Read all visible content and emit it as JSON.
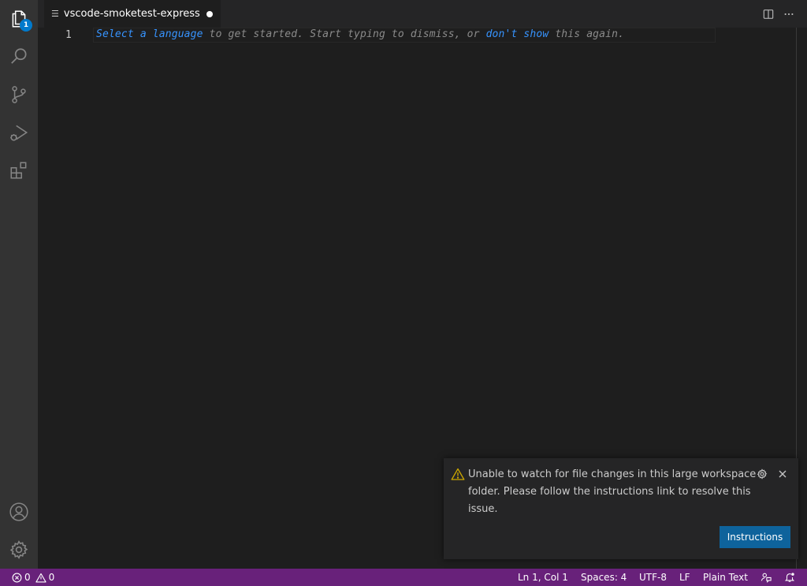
{
  "activity_bar": {
    "items": [
      {
        "name": "explorer",
        "icon": "files-icon",
        "badge": "1"
      },
      {
        "name": "search",
        "icon": "search-icon"
      },
      {
        "name": "source-control",
        "icon": "source-control-icon"
      },
      {
        "name": "run-and-debug",
        "icon": "run-debug-icon"
      },
      {
        "name": "extensions",
        "icon": "extensions-icon"
      }
    ],
    "bottom_items": [
      {
        "name": "accounts",
        "icon": "account-icon"
      },
      {
        "name": "manage",
        "icon": "gear-icon"
      }
    ]
  },
  "tabs": [
    {
      "label": "vscode-smoketest-express",
      "icon": "file-lines-icon",
      "dirty": true
    }
  ],
  "editor": {
    "line_number": "1",
    "hint": {
      "link1": "Select a language",
      "text1": " to get started. Start typing to dismiss, or ",
      "link2": "don't show",
      "text2": " this again."
    }
  },
  "notification": {
    "message": "Unable to watch for file changes in this large workspace folder. Please follow the instructions link to resolve this issue.",
    "action_label": "Instructions"
  },
  "statusbar": {
    "errors": "0",
    "warnings": "0",
    "position": "Ln 1, Col 1",
    "spaces": "Spaces: 4",
    "encoding": "UTF-8",
    "eol": "LF",
    "language": "Plain Text"
  },
  "colors": {
    "activity_bar": "#333333",
    "editor_bg": "#1e1e1e",
    "status_bar": "#68217a",
    "accent": "#007acc",
    "link": "#3794ff",
    "button": "#0e639c",
    "warning": "#cca700"
  }
}
